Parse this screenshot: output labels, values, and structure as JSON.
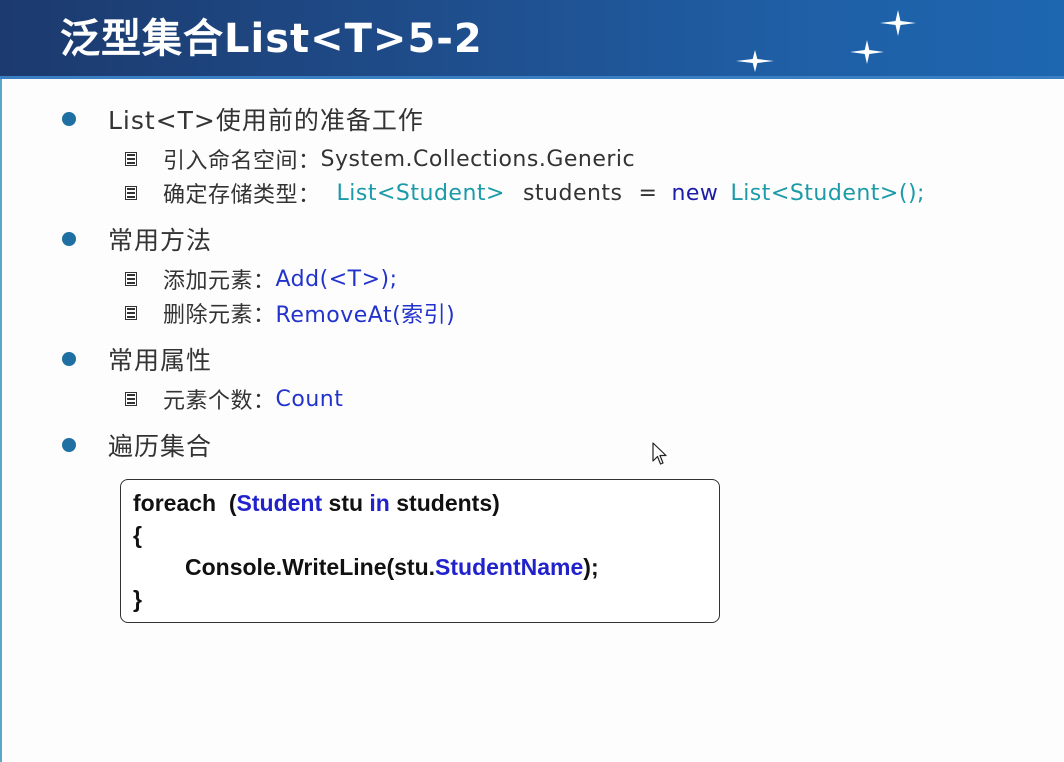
{
  "slide": {
    "title": "泛型集合List<T>5-2",
    "sections": [
      {
        "heading": "List<T>使用前的准备工作",
        "items": [
          {
            "label": "引入命名空间：",
            "value": "System.Collections.Generic"
          },
          {
            "label": "确定存储类型：",
            "code": [
              "List<Student>",
              "students",
              "=",
              "new",
              "List<Student>();"
            ]
          }
        ]
      },
      {
        "heading": "常用方法",
        "items": [
          {
            "label": "添加元素：",
            "value": "Add(<T>);"
          },
          {
            "label": "删除元素：",
            "value": "RemoveAt(索引)"
          }
        ]
      },
      {
        "heading": "常用属性",
        "items": [
          {
            "label": "元素个数：",
            "value": "Count"
          }
        ]
      },
      {
        "heading": "遍历集合",
        "items": []
      }
    ],
    "code_block": {
      "line1": [
        "foreach  (",
        "Student",
        " stu ",
        "in",
        " students)"
      ],
      "line2": "{",
      "line3": [
        "Console.WriteLine(stu.",
        "StudentName",
        ");"
      ],
      "line4": "}"
    }
  },
  "colors": {
    "header": "#1f4f8e",
    "bullet": "#1f6fa3",
    "teal": "#1b9aa8",
    "keyword": "#2222cc"
  },
  "icons": [
    "star-icon",
    "bullet-dot-icon",
    "list-square-icon",
    "mouse-cursor-icon"
  ]
}
